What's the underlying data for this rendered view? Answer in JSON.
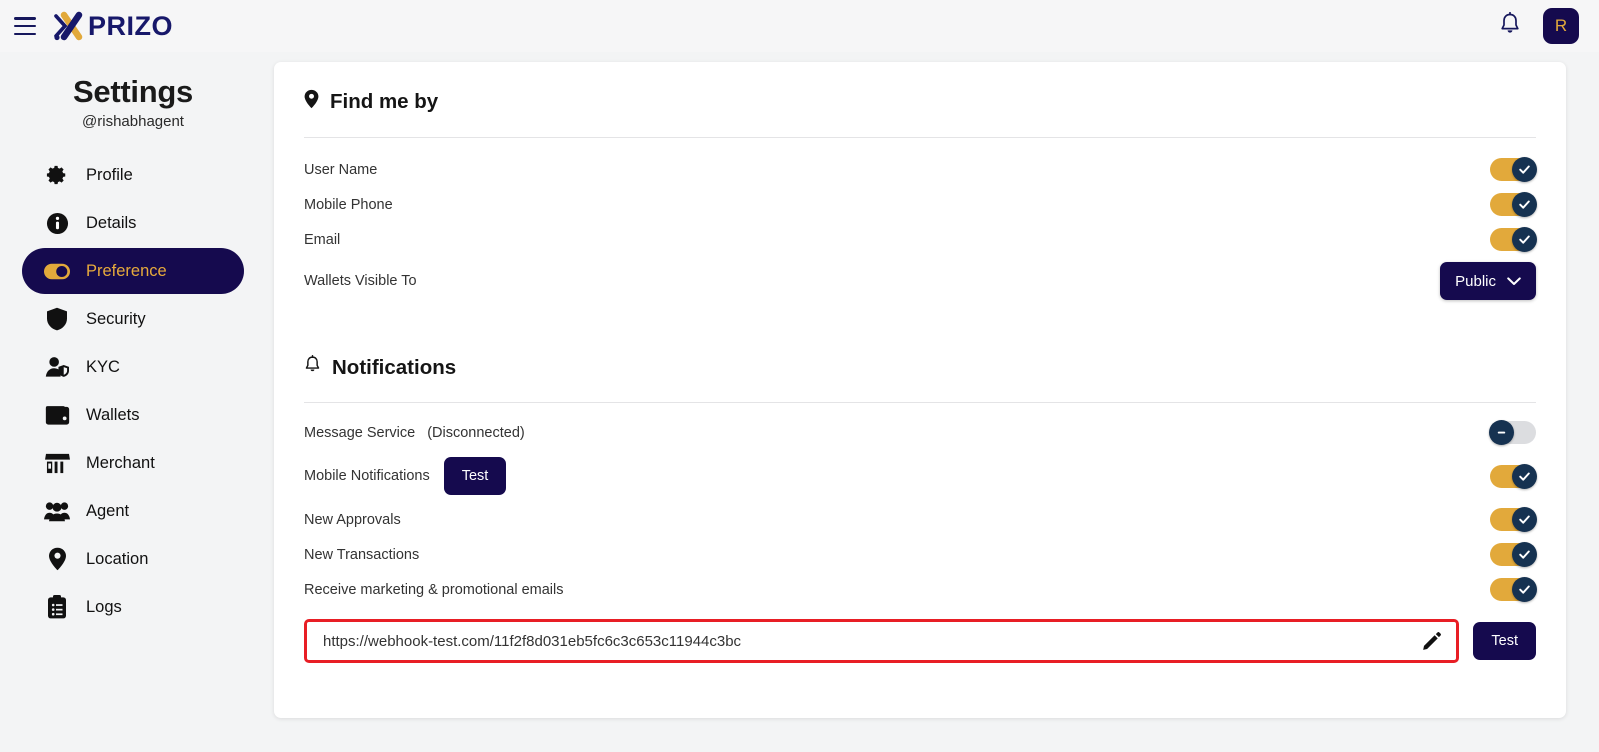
{
  "brand": {
    "logo_text": "PRIZO",
    "navy": "#150a4e",
    "gold": "#e2a93b",
    "highlight_red": "#e81e25"
  },
  "topbar": {
    "menu_icon": "hamburger-icon",
    "notifications_icon": "bell-icon",
    "avatar_initial": "R"
  },
  "sidebar": {
    "title": "Settings",
    "handle": "@rishabhagent",
    "items": [
      {
        "label": "Profile",
        "icon": "gear-icon",
        "active": false
      },
      {
        "label": "Details",
        "icon": "info-icon",
        "active": false
      },
      {
        "label": "Preference",
        "icon": "toggle-icon",
        "active": true
      },
      {
        "label": "Security",
        "icon": "shield-icon",
        "active": false
      },
      {
        "label": "KYC",
        "icon": "user-shield-icon",
        "active": false
      },
      {
        "label": "Wallets",
        "icon": "wallet-icon",
        "active": false
      },
      {
        "label": "Merchant",
        "icon": "store-icon",
        "active": false
      },
      {
        "label": "Agent",
        "icon": "people-icon",
        "active": false
      },
      {
        "label": "Location",
        "icon": "map-pin-icon",
        "active": false
      },
      {
        "label": "Logs",
        "icon": "clipboard-icon",
        "active": false
      }
    ]
  },
  "find_me_by": {
    "heading": "Find me by",
    "heading_icon": "map-pin-icon",
    "rows": [
      {
        "label": "User Name",
        "toggle": "on"
      },
      {
        "label": "Mobile Phone",
        "toggle": "on"
      },
      {
        "label": "Email",
        "toggle": "on"
      }
    ],
    "wallets_visible": {
      "label": "Wallets Visible To",
      "selected": "Public"
    }
  },
  "notifications": {
    "heading": "Notifications",
    "heading_icon": "bell-icon",
    "message_service": {
      "label": "Message Service",
      "status": "(Disconnected)",
      "toggle": "off"
    },
    "mobile_notifications": {
      "label": "Mobile Notifications",
      "test_label": "Test",
      "toggle": "on"
    },
    "rows": [
      {
        "label": "New Approvals",
        "toggle": "on"
      },
      {
        "label": "New Transactions",
        "toggle": "on"
      },
      {
        "label": "Receive marketing & promotional emails",
        "toggle": "on"
      }
    ],
    "webhook": {
      "url": "https://webhook-test.com/11f2f8d031eb5fc6c3c653c11944c3bc",
      "edit_icon": "pencil-icon",
      "test_label": "Test"
    }
  }
}
